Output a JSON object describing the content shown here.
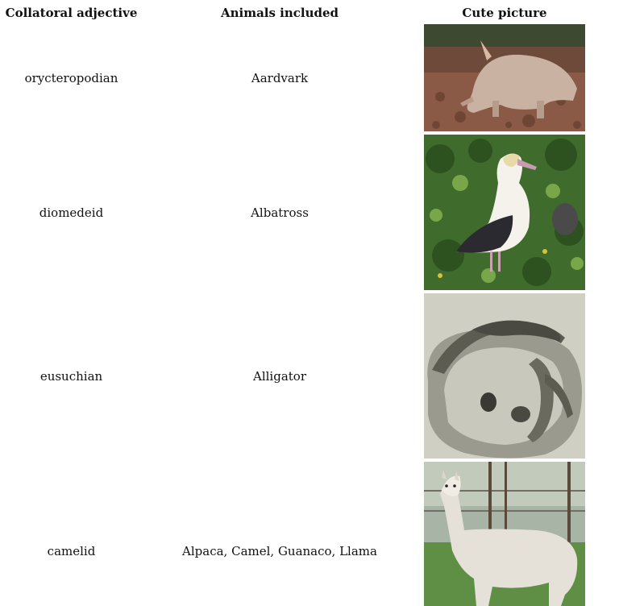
{
  "table": {
    "headers": [
      "Collatoral adjective",
      "Animals included",
      "Cute picture"
    ],
    "rows": [
      {
        "adjective": "orycteropodian",
        "animals": "Aardvark",
        "picture_icon": "aardvark-photo"
      },
      {
        "adjective": "diomedeid",
        "animals": "Albatross",
        "picture_icon": "albatross-photo"
      },
      {
        "adjective": "eusuchian",
        "animals": "Alligator",
        "picture_icon": "alligator-photo"
      },
      {
        "adjective": "camelid",
        "animals": "Alpaca, Camel, Guanaco, Llama",
        "picture_icon": "alpaca-photo"
      }
    ]
  }
}
